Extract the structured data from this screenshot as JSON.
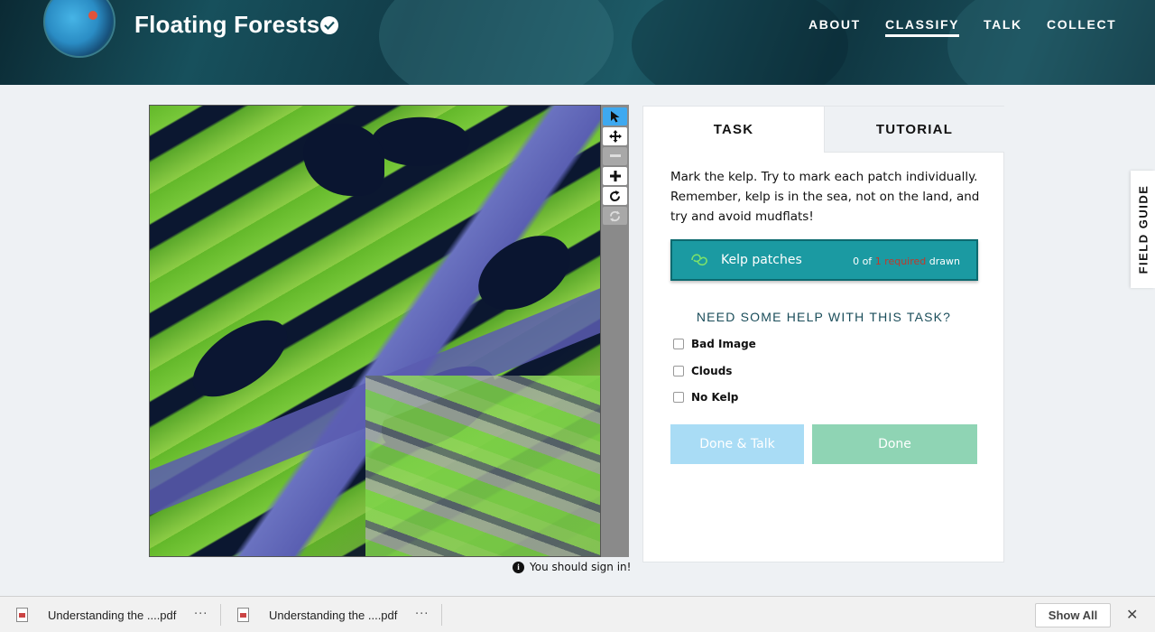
{
  "header": {
    "project_title": "Floating Forests",
    "nav": [
      "ABOUT",
      "CLASSIFY",
      "TALK",
      "COLLECT"
    ],
    "active_nav": "CLASSIFY"
  },
  "viewer": {
    "tools": [
      "pointer-icon",
      "move-icon",
      "zoom-out-icon",
      "zoom-in-icon",
      "rotate-icon",
      "reset-icon"
    ],
    "sign_in_notice": "You should sign in!"
  },
  "task_panel": {
    "tabs": [
      "TASK",
      "TUTORIAL"
    ],
    "instructions": "Mark the kelp. Try to mark each patch individually. Remember, kelp is in the sea, not on the land, and try and avoid mudflats!",
    "tool": {
      "label": "Kelp patches",
      "count_prefix": "0 of",
      "count_required": "1 required",
      "count_suffix": "drawn"
    },
    "help_title": "NEED SOME HELP WITH THIS TASK?",
    "options": [
      "Bad Image",
      "Clouds",
      "No Kelp"
    ],
    "done_talk_label": "Done & Talk",
    "done_label": "Done"
  },
  "field_guide": {
    "label": "FIELD GUIDE"
  },
  "downloads": {
    "items": [
      "Understanding the ....pdf",
      "Understanding the ....pdf"
    ],
    "more": "···",
    "show_all": "Show All",
    "close": "✕"
  },
  "colors": {
    "accent_teal": "#1b9aa2",
    "active_tool": "#3ea9f0",
    "done_talk": "#a9dcf5",
    "done": "#8fd4b4"
  }
}
